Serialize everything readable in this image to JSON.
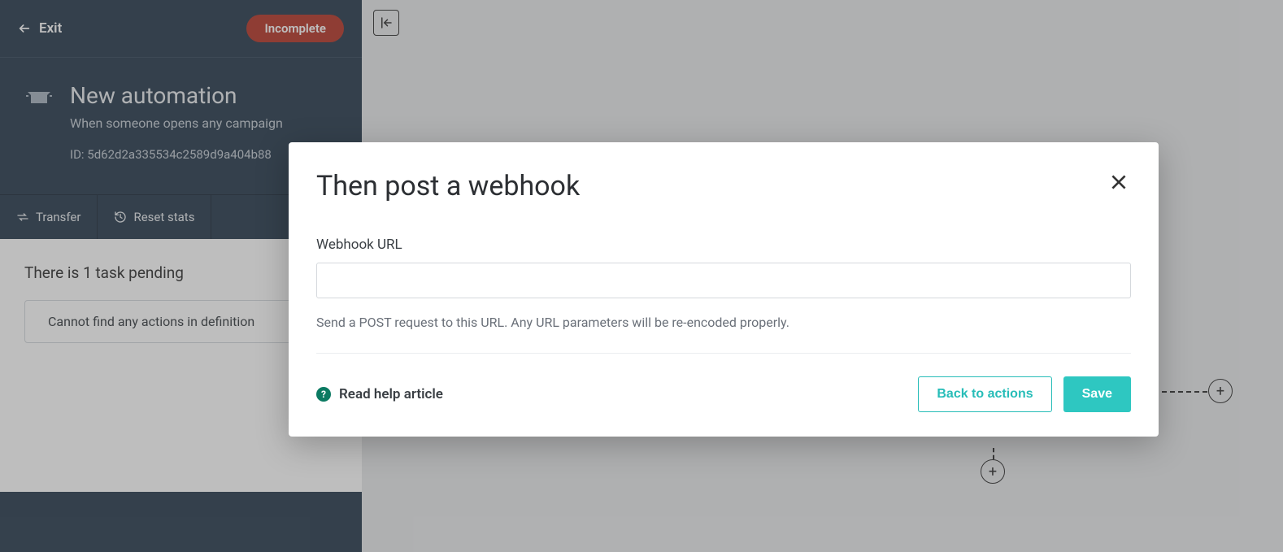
{
  "sidebar": {
    "exit_label": "Exit",
    "status_badge": "Incomplete",
    "title": "New automation",
    "description": "When someone opens any campaign",
    "id_label": "ID: 5d62d2a335534c2589d9a404b88",
    "tabs": {
      "transfer": "Transfer",
      "reset": "Reset stats"
    },
    "task_heading": "There is 1 task pending",
    "task_item": "Cannot find any actions in definition"
  },
  "modal": {
    "title": "Then post a webhook",
    "field_label": "Webhook URL",
    "input_value": "",
    "help_text": "Send a POST request to this URL. Any URL parameters will be re-encoded properly.",
    "help_link": "Read help article",
    "back_button": "Back to actions",
    "save_button": "Save"
  }
}
